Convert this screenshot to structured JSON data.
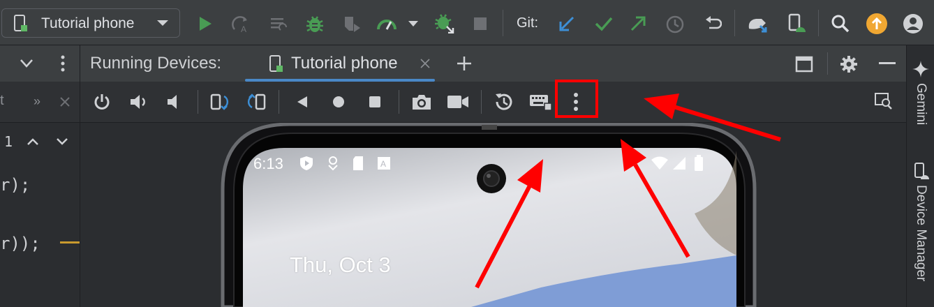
{
  "toolbar": {
    "device_label": "Tutorial phone",
    "git_label": "Git:",
    "icons": [
      "phone-icon",
      "chevron-down-icon",
      "run-icon",
      "apply-changes-icon",
      "apply-code-changes-icon",
      "debug-icon",
      "attach-debugger-icon",
      "profiler-icon",
      "profiler-dropdown-icon",
      "bug-arrow-icon",
      "stop-icon",
      "git-update-icon",
      "git-commit-icon",
      "git-push-icon",
      "git-history-icon",
      "git-rollback-icon",
      "device-mirror-icon",
      "device-manager-icon",
      "search-icon",
      "update-icon",
      "account-icon"
    ]
  },
  "left_panel": {
    "line_counter": "1",
    "code_line_1": "r);",
    "code_line_2": "r));"
  },
  "running_devices": {
    "title": "Running Devices:",
    "tab_label": "Tutorial phone"
  },
  "right_strip": {
    "gemini_label": "Gemini",
    "device_manager_label": "Device Manager"
  },
  "phone": {
    "time": "6:13",
    "date": "Thu, Oct 3"
  },
  "colors": {
    "accent": "#4a88c7",
    "run_green": "#499c54",
    "annotation_red": "#ff0000",
    "orange_badge": "#f0a732"
  }
}
